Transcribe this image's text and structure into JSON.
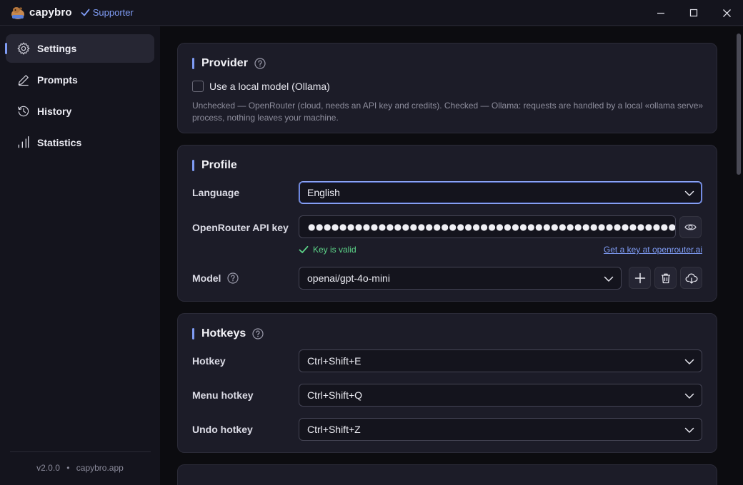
{
  "titlebar": {
    "app_name": "capybro",
    "supporter_label": "Supporter",
    "icons": [
      "capybara-logo-icon",
      "check-icon",
      "minimize-icon",
      "maximize-icon",
      "close-icon"
    ]
  },
  "sidebar": {
    "items": [
      {
        "label": "Settings",
        "icon": "gear-icon",
        "active": true
      },
      {
        "label": "Prompts",
        "icon": "pen-icon",
        "active": false
      },
      {
        "label": "History",
        "icon": "history-icon",
        "active": false
      },
      {
        "label": "Statistics",
        "icon": "bar-chart-icon",
        "active": false
      }
    ],
    "footer": {
      "version": "v2.0.0",
      "separator": "•",
      "site": "capybro.app"
    }
  },
  "provider": {
    "title": "Provider",
    "checkbox_label": "Use a local model (Ollama)",
    "checked": false,
    "description": "Unchecked — OpenRouter (cloud, needs an API key and credits). Checked — Ollama: requests are handled by a local «ollama serve» process, nothing leaves your machine."
  },
  "profile": {
    "title": "Profile",
    "language_label": "Language",
    "language_value": "English",
    "api_key_label": "OpenRouter API key",
    "api_key_masked": "●●●●●●●●●●●●●●●●●●●●●●●●●●●●●●●●●●●●●●●●●●●●●●●●●●●●●●●●●●●●●●●",
    "key_status": "Key is valid",
    "get_key_link": "Get a key at openrouter.ai",
    "model_label": "Model",
    "model_value": "openai/gpt-4o-mini"
  },
  "hotkeys": {
    "title": "Hotkeys",
    "rows": [
      {
        "label": "Hotkey",
        "value": "Ctrl+Shift+E"
      },
      {
        "label": "Menu hotkey",
        "value": "Ctrl+Shift+Q"
      },
      {
        "label": "Undo hotkey",
        "value": "Ctrl+Shift+Z"
      }
    ]
  },
  "colors": {
    "accent": "#7f9cf5",
    "valid": "#5dd589",
    "card_bg": "#1c1c28",
    "sidebar_bg": "#14141d",
    "main_bg": "#0c0c10"
  }
}
